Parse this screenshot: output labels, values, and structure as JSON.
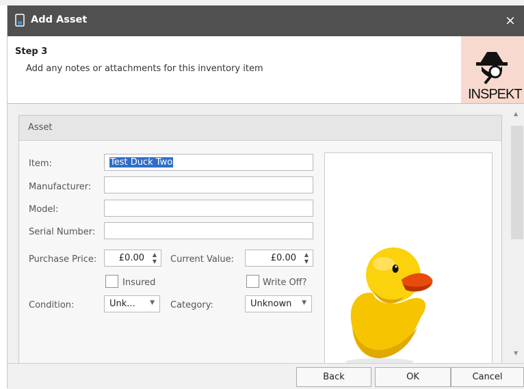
{
  "window": {
    "title": "Add Asset",
    "close_glyph": "×"
  },
  "header": {
    "step": "Step 3",
    "description": "Add any notes or attachments for this inventory item",
    "logo_text": "INSPEKT"
  },
  "group": {
    "title": "Asset"
  },
  "form": {
    "item_label": "Item:",
    "item_value": "Test Duck Two",
    "manufacturer_label": "Manufacturer:",
    "manufacturer_value": "",
    "model_label": "Model:",
    "model_value": "",
    "serial_label": "Serial Number:",
    "serial_value": "",
    "purchase_price_label": "Purchase Price:",
    "purchase_price_value": "£0.00",
    "current_value_label": "Current Value:",
    "current_value_value": "£0.00",
    "insured_label": "Insured",
    "insured_checked": false,
    "write_off_label": "Write Off?",
    "write_off_checked": false,
    "condition_label": "Condition:",
    "condition_value": "Unk...",
    "category_label": "Category:",
    "category_value": "Unknown"
  },
  "buttons": {
    "back": "Back",
    "ok": "OK",
    "cancel": "Cancel"
  },
  "icons": {
    "app": "device-icon",
    "close": "close-icon",
    "spin_up": "▲",
    "spin_down": "▼",
    "dropdown": "▼"
  },
  "colors": {
    "titlebar": "#505050",
    "selection": "#2f6ec8",
    "logo_bg": "#f7d9cf"
  }
}
